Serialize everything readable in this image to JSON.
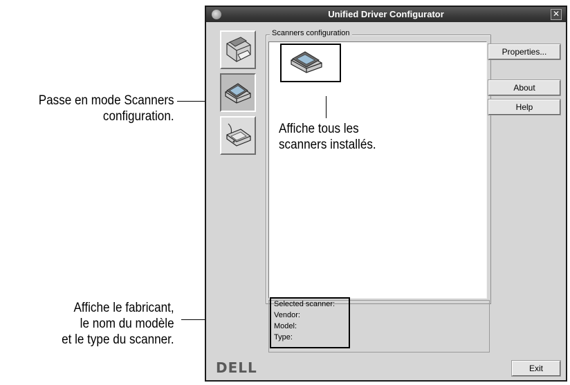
{
  "window": {
    "title": "Unified Driver Configurator"
  },
  "groupbox": {
    "title": "Scanners configuration"
  },
  "buttons": {
    "properties": "Properties...",
    "about": "About",
    "help": "Help",
    "exit": "Exit"
  },
  "info": {
    "selected_scanner": "Selected scanner:",
    "vendor": "Vendor:",
    "model": "Model:",
    "type": "Type:"
  },
  "logo": "DELL",
  "callouts": {
    "mode_line1": "Passe en mode Scanners",
    "mode_line2": "configuration.",
    "list_line1": "Affiche tous les",
    "list_line2": "scanners installés.",
    "info_line1": "Affiche le fabricant,",
    "info_line2": "le  nom du modèle",
    "info_line3": "et le type du scanner."
  },
  "icons": {
    "sidebar": [
      "printer-icon",
      "scanner-icon",
      "port-icon"
    ],
    "list_item": "scanner-icon",
    "window": "app-icon"
  }
}
